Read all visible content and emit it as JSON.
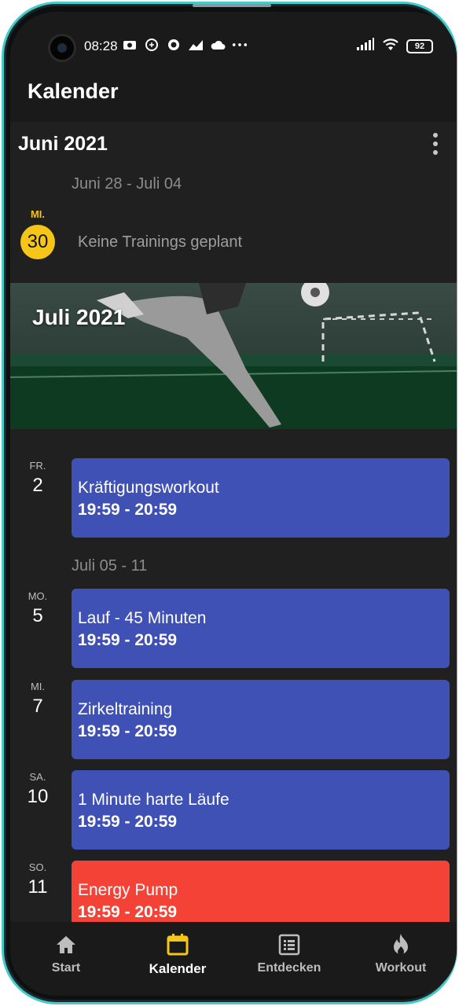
{
  "status_bar": {
    "time": "08:28",
    "battery": "92",
    "icons": [
      "photo-icon",
      "sync-icon",
      "record-icon",
      "chart-icon",
      "cloud-icon",
      "more-dots-icon"
    ]
  },
  "app_bar": {
    "title": "Kalender"
  },
  "calendar": {
    "month_june": "Juni 2021",
    "week_1": "Juni 28 - Juli 04",
    "today": {
      "abbr": "MI.",
      "num": "30"
    },
    "no_training": "Keine Trainings geplant",
    "month_july": "Juli 2021",
    "week_2": "Juli 05 - 11",
    "events": [
      {
        "day_abbr": "FR.",
        "day_num": "2",
        "title": "Kräftigungsworkout",
        "time": "19:59 - 20:59",
        "color": "#3f51b5"
      },
      {
        "day_abbr": "MO.",
        "day_num": "5",
        "title": "Lauf - 45 Minuten",
        "time": "19:59 - 20:59",
        "color": "#3f51b5"
      },
      {
        "day_abbr": "MI.",
        "day_num": "7",
        "title": "Zirkeltraining",
        "time": "19:59 - 20:59",
        "color": "#3f51b5"
      },
      {
        "day_abbr": "SA.",
        "day_num": "10",
        "title": "1 Minute harte Läufe",
        "time": "19:59 - 20:59",
        "color": "#3f51b5"
      },
      {
        "day_abbr": "SO.",
        "day_num": "11",
        "title": "Energy Pump",
        "time": "19:59 - 20:59",
        "color": "#f44336"
      }
    ]
  },
  "bottom_nav": {
    "items": [
      {
        "label": "Start",
        "icon": "home-icon"
      },
      {
        "label": "Kalender",
        "icon": "calendar-icon",
        "active": true
      },
      {
        "label": "Entdecken",
        "icon": "list-icon"
      },
      {
        "label": "Workout",
        "icon": "flame-icon"
      }
    ]
  },
  "colors": {
    "accent": "#f5c518",
    "event_blue": "#3f51b5",
    "event_red": "#f44336",
    "background": "#202020"
  }
}
